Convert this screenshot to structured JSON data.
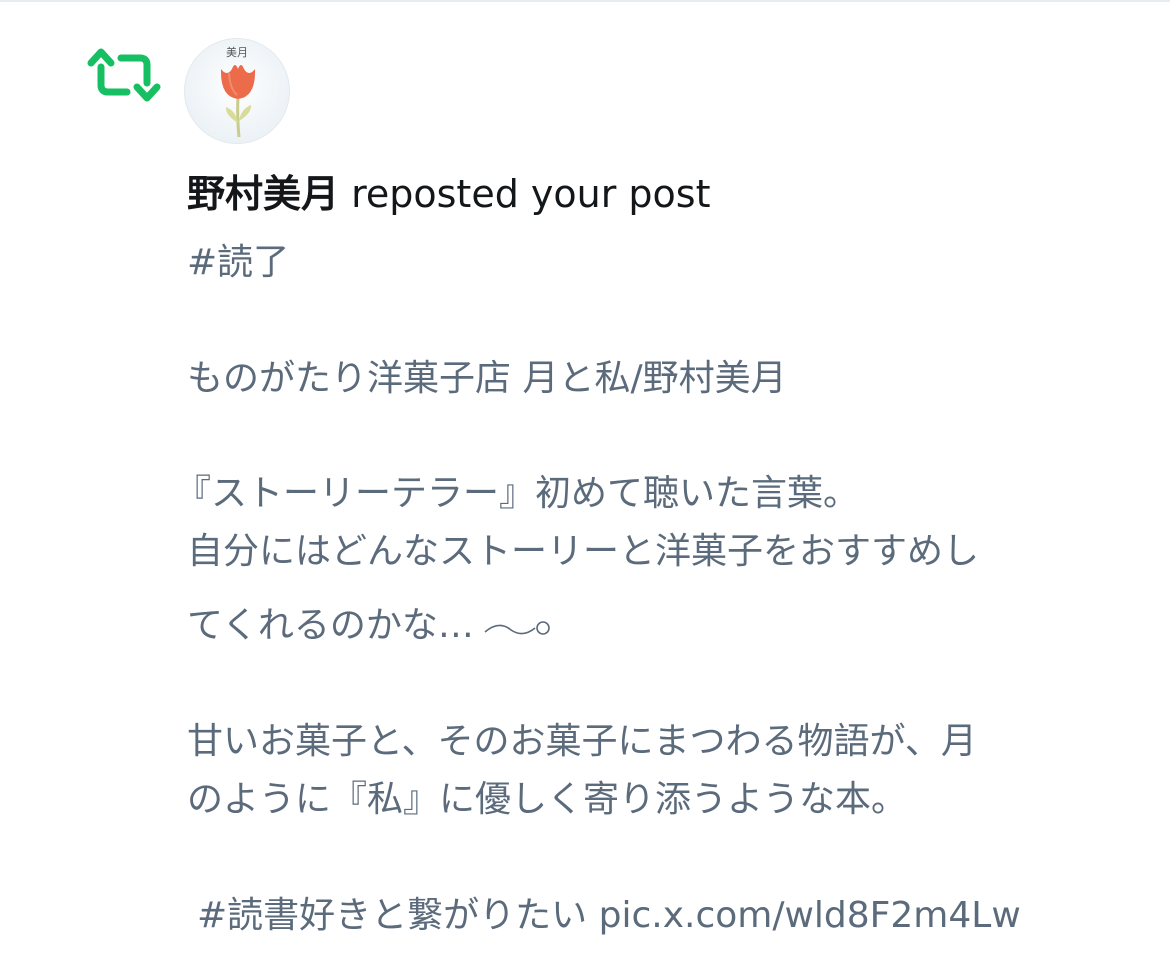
{
  "notification": {
    "type_icon": "repost-icon",
    "avatar": {
      "icon": "tulip-avatar-icon",
      "text": "美月"
    },
    "user_name": "野村美月",
    "action_text": " reposted your post",
    "accent_color": "#17bf63"
  },
  "post": {
    "hashtag_top": "#読了",
    "book_line": "ものがたり洋菓子店 月と私/野村美月",
    "paragraph1": [
      "『ストーリーテラー』初めて聴いた言葉。",
      "自分にはどんなストーリーと洋菓子をおすすめし",
      "てくれるのかな…"
    ],
    "paragraph2": [
      "甘いお菓子と、そのお菓子にまつわる物語が、月",
      "のように『私』に優しく寄り添うような本。"
    ],
    "hashtag_bottom": "#読書好きと繋がりたい",
    "link": "pic.x.com/wld8F2m4Lw"
  }
}
